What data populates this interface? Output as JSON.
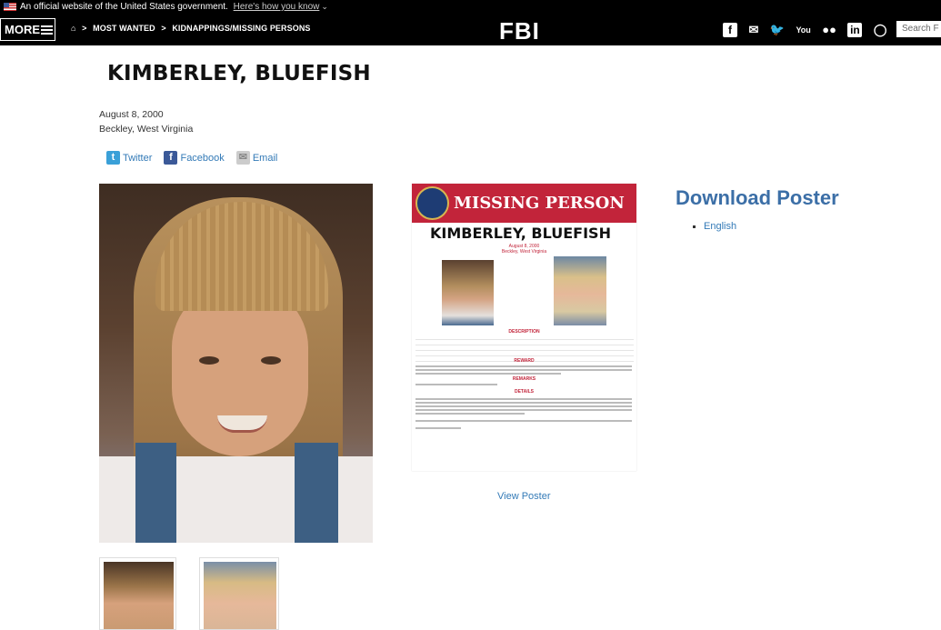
{
  "gov_banner": {
    "text": "An official website of the United States government.",
    "link": "Here's how you know"
  },
  "nav": {
    "more_label": "MORE",
    "breadcrumb": [
      "MOST WANTED",
      "KIDNAPPINGS/MISSING PERSONS"
    ],
    "logo": "FBI",
    "search_placeholder": "Search F",
    "social_icons": [
      "facebook-icon",
      "email-icon",
      "twitter-icon",
      "youtube-icon",
      "flickr-icon",
      "linkedin-icon",
      "instagram-icon"
    ]
  },
  "case": {
    "title": "KIMBERLEY, BLUEFISH",
    "date": "August 8, 2000",
    "place": "Beckley, West Virginia"
  },
  "share": {
    "twitter": "Twitter",
    "facebook": "Facebook",
    "email": "Email"
  },
  "poster": {
    "banner": "MISSING PERSON",
    "name": "KIMBERLEY, BLUEFISH",
    "date": "August 8, 2000",
    "place": "Beckley, West Virginia",
    "sections": [
      "DESCRIPTION",
      "REWARD",
      "REMARKS",
      "DETAILS"
    ],
    "view_label": "View Poster"
  },
  "download": {
    "title": "Download Poster",
    "languages": [
      "English"
    ]
  },
  "colors": {
    "link": "#337ab7",
    "heading_blue": "#3c6fa7",
    "poster_red": "#c2243a",
    "nav_bg": "#000000"
  }
}
